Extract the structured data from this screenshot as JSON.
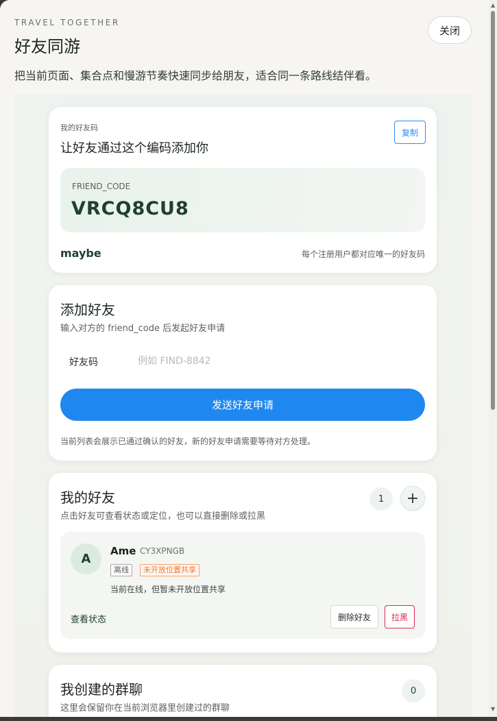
{
  "header": {
    "eyebrow": "TRAVEL TOGETHER",
    "title": "好友同游",
    "subtitle": "把当前页面、集合点和慢游节奏快速同步给朋友，适合同一条路线结伴看。",
    "close_label": "关闭"
  },
  "friend_code_card": {
    "small_label": "我的好友码",
    "heading": "让好友通过这个编码添加你",
    "copy_label": "复制",
    "code_label": "FRIEND_CODE",
    "code_value": "VRCQ8CU8",
    "username": "maybe",
    "hint": "每个注册用户都对应唯一的好友码"
  },
  "add_friend_card": {
    "heading": "添加好友",
    "desc": "输入对方的 friend_code 后发起好友申请",
    "field_label": "好友码",
    "field_placeholder": "例如 FIND-8842",
    "field_value": "",
    "send_label": "发送好友申请",
    "note": "当前列表会展示已通过确认的好友，新的好友申请需要等待对方处理。"
  },
  "my_friends_card": {
    "heading": "我的好友",
    "desc": "点击好友可查看状态或定位，也可以直接删除或拉黑",
    "count": "1",
    "add_icon": "plus-icon",
    "friends": [
      {
        "avatar": "A",
        "name": "Ame",
        "code": "CY3XPNGB",
        "tag_offline": "离线",
        "tag_location": "未开放位置共享",
        "status": "当前在线，但暂未开放位置共享",
        "view_label": "查看状态",
        "delete_label": "删除好友",
        "block_label": "拉黑"
      }
    ]
  },
  "groups_card": {
    "heading": "我创建的群聊",
    "desc": "这里会保留你在当前浏览器里创建过的群聊",
    "count": "0"
  },
  "colors": {
    "primary": "#1f88f0",
    "accent_green": "#1f4030",
    "danger": "#e0244a",
    "warning": "#ef7a36"
  }
}
